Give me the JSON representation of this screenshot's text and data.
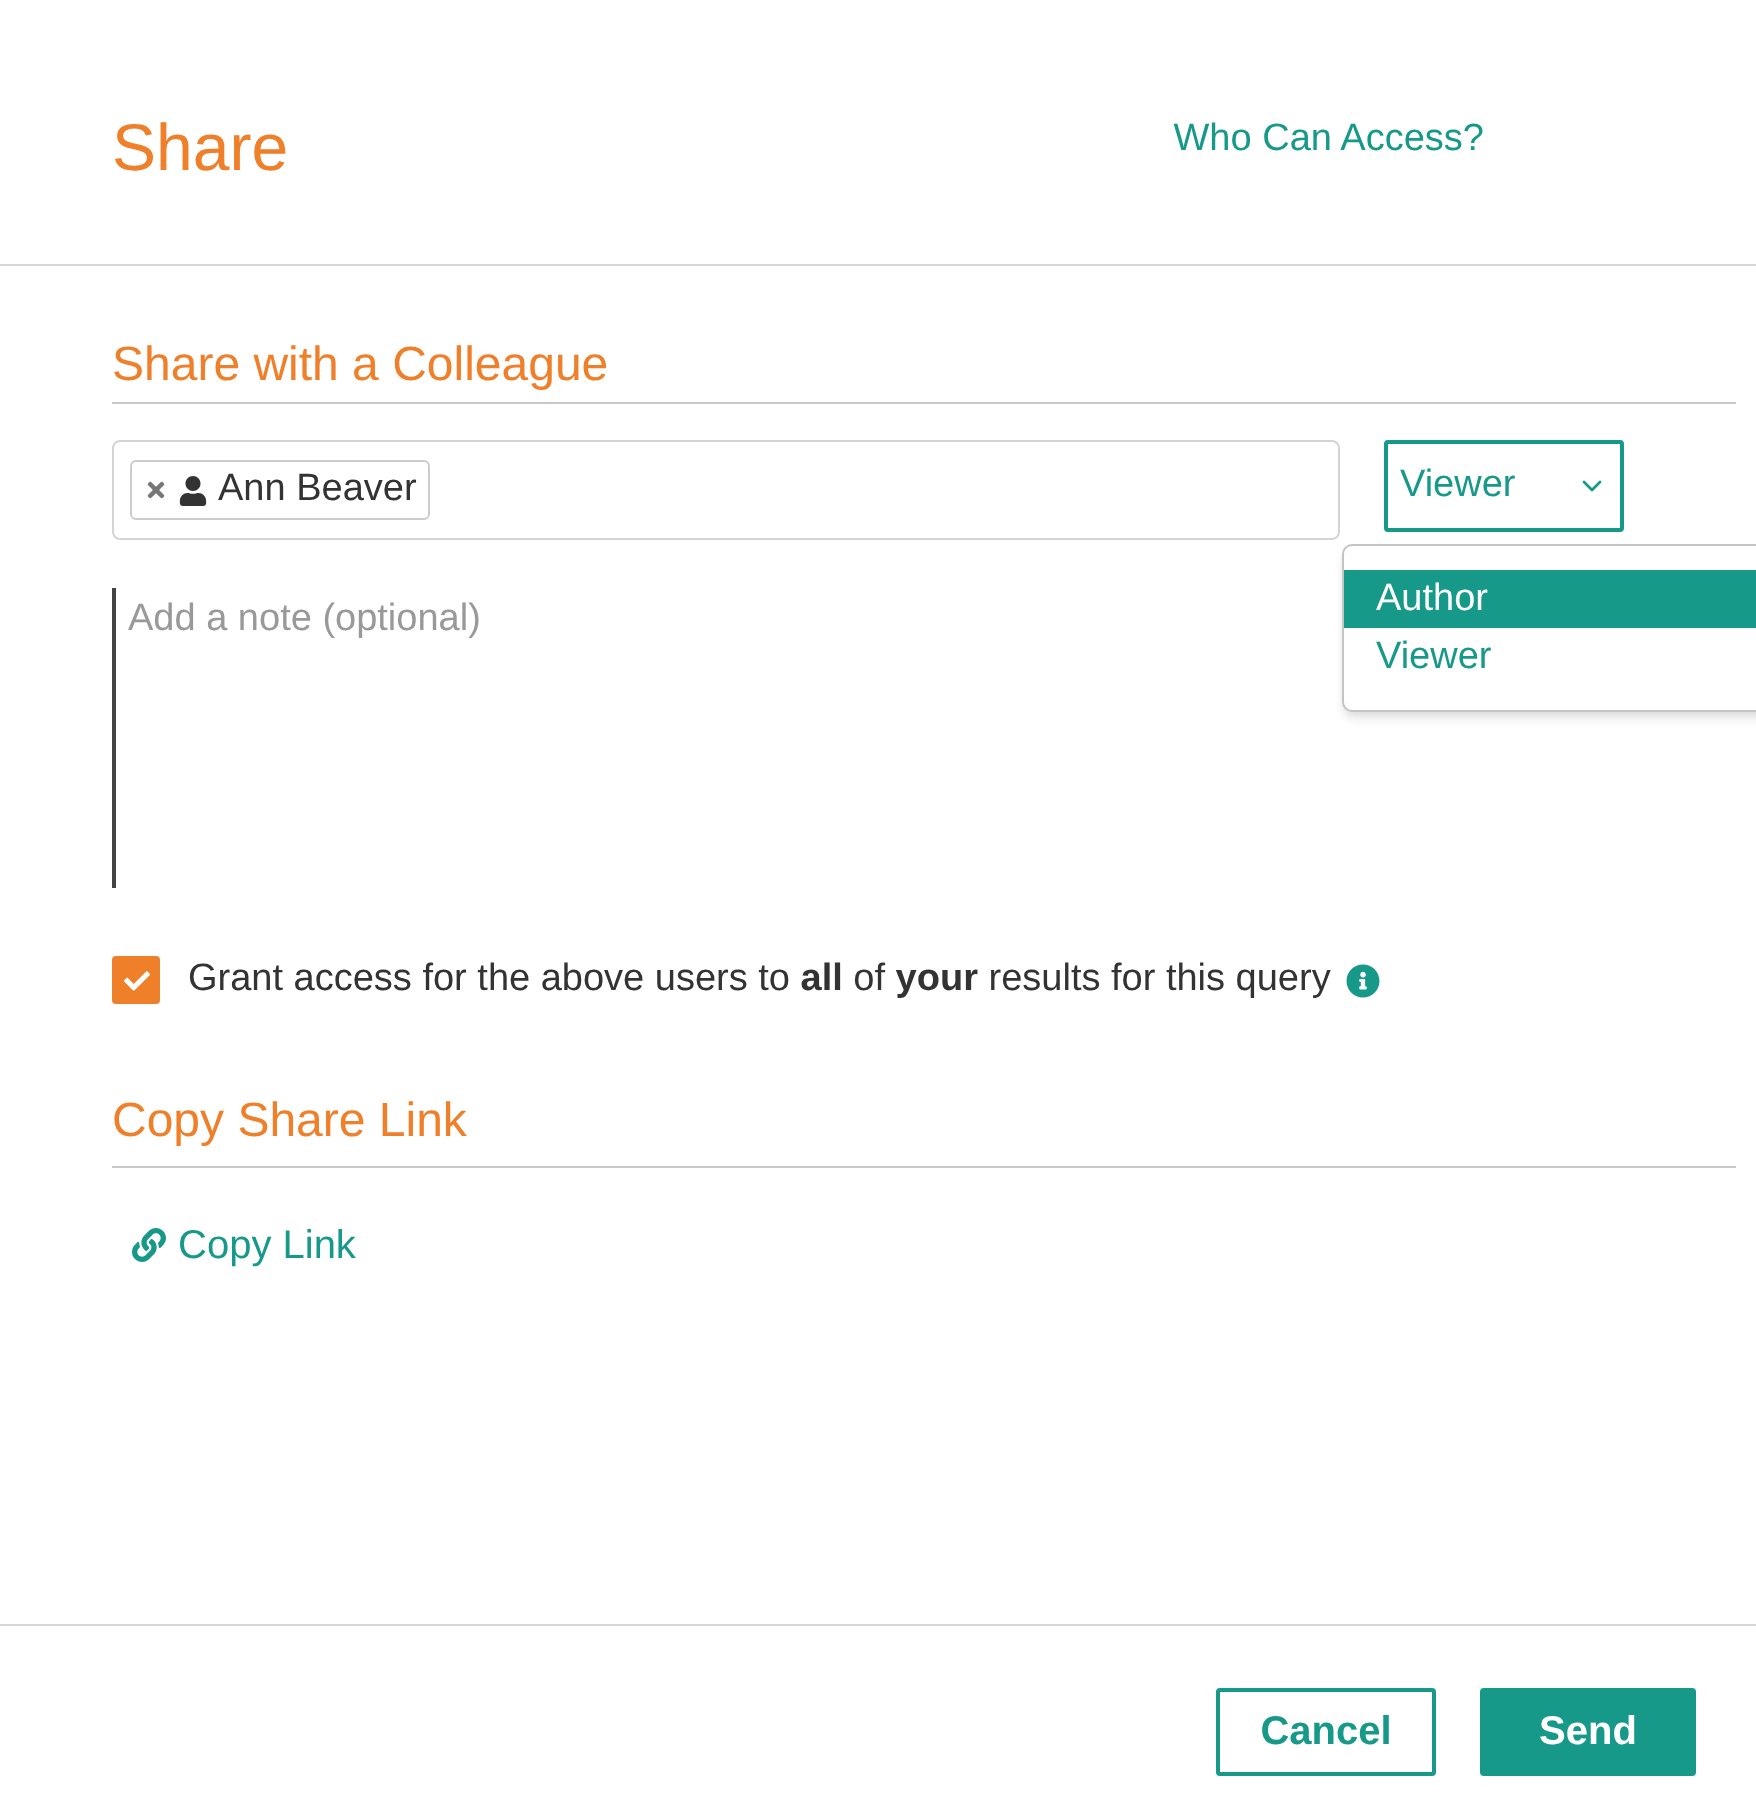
{
  "dialog": {
    "title": "Share",
    "access_link": "Who Can Access?"
  },
  "colleague": {
    "heading": "Share with a Colleague",
    "recipients": [
      {
        "name": "Ann Beaver"
      }
    ],
    "role": {
      "value": "Viewer",
      "options": [
        {
          "label": "Author",
          "highlighted": true
        },
        {
          "label": "Viewer",
          "highlighted": false
        }
      ]
    },
    "note": {
      "placeholder": "Add a note (optional)"
    },
    "grant": {
      "checked": true,
      "text": "Grant access for the above users to **all** of **your** results for this query"
    }
  },
  "copy": {
    "heading": "Copy Share Link",
    "link": "Copy Link"
  },
  "buttons": [
    {
      "label": "Cancel",
      "kind": "secondary"
    },
    {
      "label": "Send",
      "kind": "primary"
    }
  ]
}
